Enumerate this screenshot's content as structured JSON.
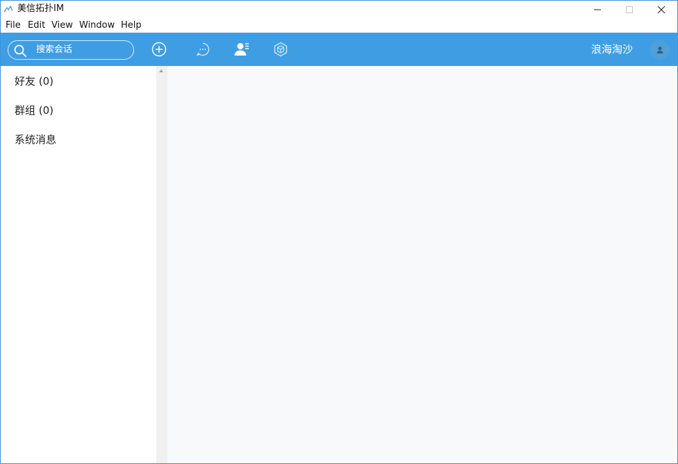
{
  "window": {
    "title": "美信拓扑IM",
    "accent_color": "#3f9ee3"
  },
  "menu": {
    "items": [
      "File",
      "Edit",
      "View",
      "Window",
      "Help"
    ]
  },
  "toolbar": {
    "search_placeholder": "搜索会话",
    "icons": [
      "add-circle-icon",
      "chat-bubble-icon",
      "contacts-icon",
      "cube-icon"
    ],
    "username": "浪海淘沙"
  },
  "sidebar": {
    "items": [
      {
        "label": "好友 (0)"
      },
      {
        "label": "群组 (0)"
      },
      {
        "label": "系统消息"
      }
    ]
  }
}
